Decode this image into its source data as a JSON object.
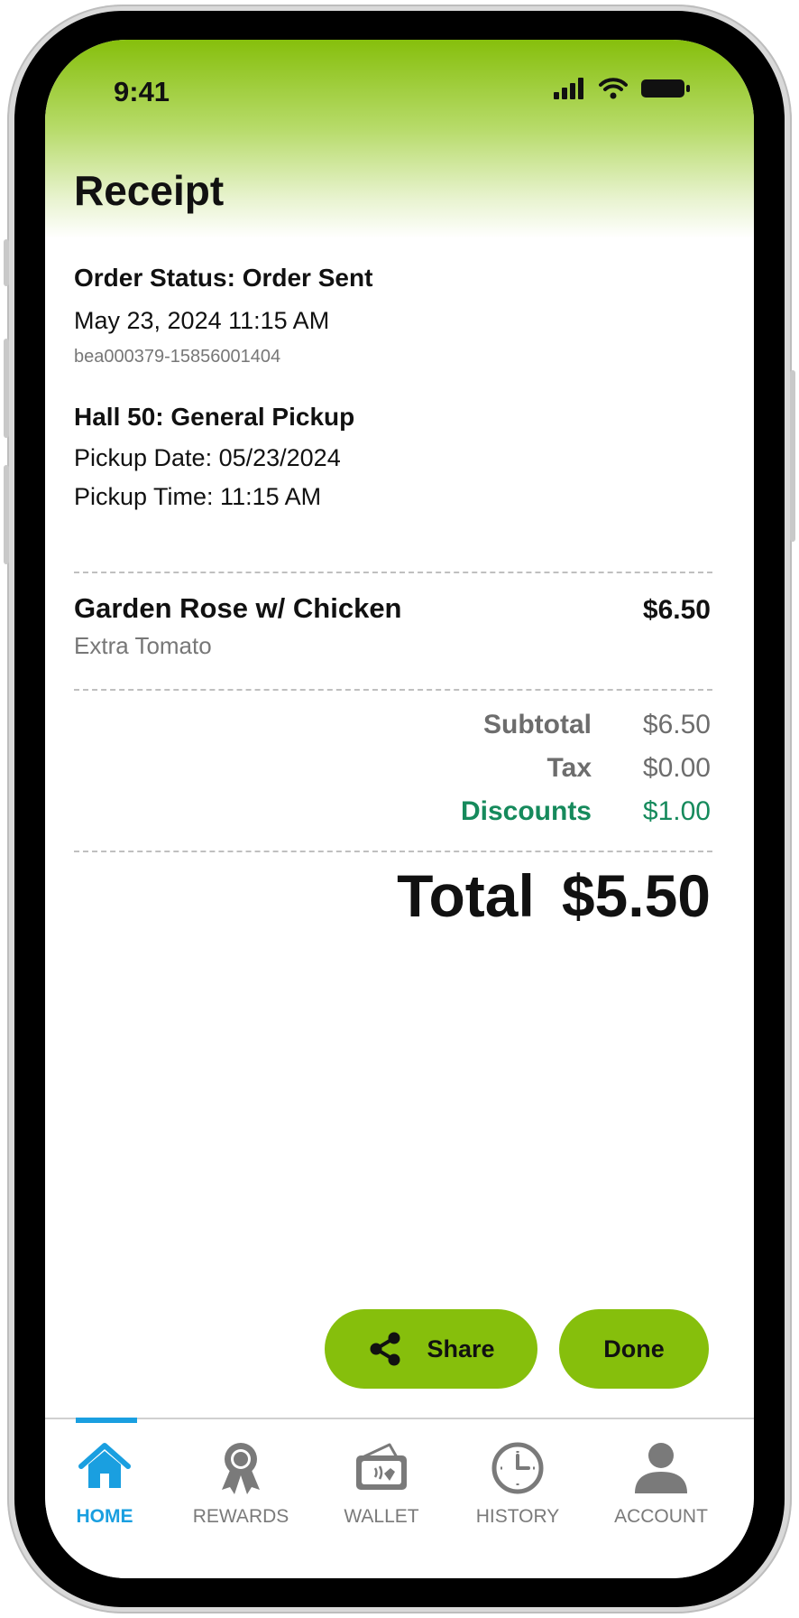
{
  "status_bar": {
    "time": "9:41"
  },
  "header": {
    "title": "Receipt"
  },
  "order": {
    "status": "Order Status: Order Sent",
    "datetime": "May 23, 2024 11:15 AM",
    "order_id": "bea000379-15856001404",
    "location": "Hall 50: General Pickup",
    "pickup_date": "Pickup Date: 05/23/2024",
    "pickup_time": "Pickup Time: 11:15 AM"
  },
  "items": [
    {
      "name": "Garden Rose w/ Chicken",
      "modifier": "Extra Tomato",
      "price": "$6.50"
    }
  ],
  "summary": {
    "subtotal_label": "Subtotal",
    "subtotal": "$6.50",
    "tax_label": "Tax",
    "tax": "$0.00",
    "discounts_label": "Discounts",
    "discounts": "$1.00",
    "total_label": "Total",
    "total": "$5.50"
  },
  "actions": {
    "share_label": "Share",
    "done_label": "Done"
  },
  "tabs": [
    {
      "label": "HOME",
      "icon": "home-icon",
      "active": true
    },
    {
      "label": "REWARDS",
      "icon": "rewards-ribbon-icon"
    },
    {
      "label": "WALLET",
      "icon": "wallet-icon"
    },
    {
      "label": "HISTORY",
      "icon": "clock-icon"
    },
    {
      "label": "ACCOUNT",
      "icon": "person-icon"
    }
  ],
  "colors": {
    "brand_green": "#86bf0c",
    "discount_green": "#168a5c",
    "active_tab_blue": "#1a9fe0",
    "inactive_tab_gray": "#7a7a7a"
  }
}
